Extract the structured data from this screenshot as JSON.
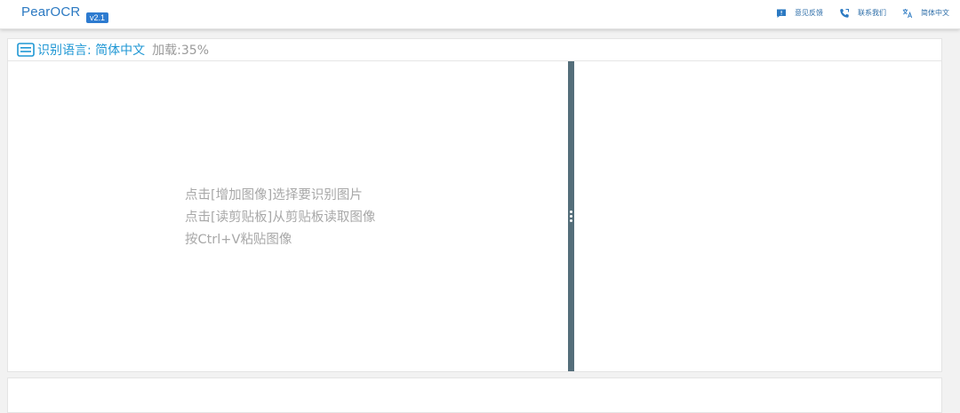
{
  "app": {
    "title": "PearOCR",
    "version": "v2.1"
  },
  "header": {
    "actions": [
      {
        "label": "意见反馈",
        "icon": "feedback-icon"
      },
      {
        "label": "联系我们",
        "icon": "phone-icon"
      },
      {
        "label": "简体中文",
        "icon": "translate-icon"
      }
    ]
  },
  "panel": {
    "language_label": "识别语言: 简体中文",
    "load_status": "加载:35%",
    "load_progress": 0.35,
    "hints": [
      "点击[增加图像]选择要识别图片",
      "点击[读剪贴板]从剪贴板读取图像",
      "按Ctrl+V粘贴图像"
    ]
  },
  "colors": {
    "brand": "#2b79c2",
    "badge": "#2d7bd0",
    "accent": "#1f97d4",
    "divider": "#546e7a",
    "muted_text": "#a8a8a8"
  }
}
